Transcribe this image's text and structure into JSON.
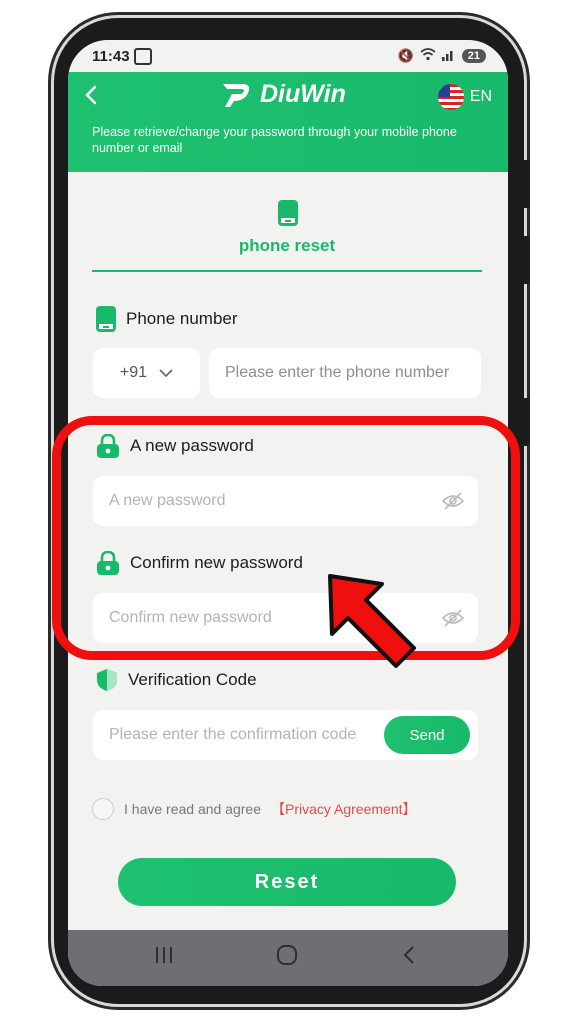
{
  "status_bar": {
    "time": "11:43",
    "battery": "21"
  },
  "header": {
    "brand": "DiuWin",
    "language": "EN",
    "subtitle": "Please retrieve/change your password through your mobile phone number or email"
  },
  "tab": {
    "label": "phone reset"
  },
  "phone": {
    "title": "Phone number",
    "country_code": "+91",
    "placeholder": "Please enter the phone number"
  },
  "new_password": {
    "title": "A new password",
    "placeholder": "A new password"
  },
  "confirm_password": {
    "title": "Confirm new password",
    "placeholder": "Confirm new password"
  },
  "verification": {
    "title": "Verification Code",
    "placeholder": "Please enter the confirmation code",
    "send_label": "Send"
  },
  "agreement": {
    "text": "I have read and agree",
    "link": "【Privacy Agreement】"
  },
  "reset_label": "Reset",
  "colors": {
    "brand_green": "#19b96b",
    "annotation_red": "#f00f0f",
    "link_red": "#e8484a"
  },
  "icons": [
    "back-arrow-icon",
    "logo-icon",
    "us-flag-icon",
    "phone-icon",
    "lock-icon",
    "shield-icon",
    "eye-off-icon",
    "chevron-down-icon"
  ]
}
